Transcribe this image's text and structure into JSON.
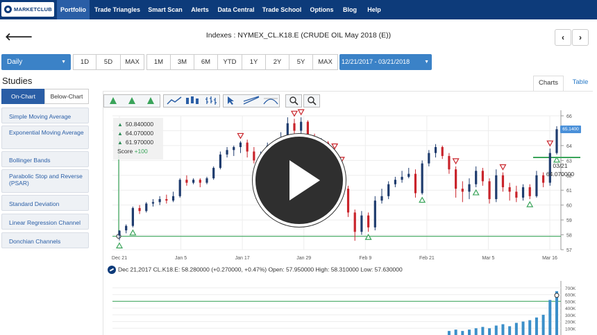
{
  "brand": {
    "logo_text": "MARKETCLUB"
  },
  "nav": {
    "items": [
      {
        "label": "Portfolio",
        "active": true
      },
      {
        "label": "Trade Triangles"
      },
      {
        "label": "Smart Scan"
      },
      {
        "label": "Alerts"
      },
      {
        "label": "Data Central"
      },
      {
        "label": "Trade School"
      },
      {
        "label": "Options"
      },
      {
        "label": "Blog"
      },
      {
        "label": "Help"
      }
    ]
  },
  "header": {
    "back_glyph": "🡐",
    "title": "Indexes : NYMEX_CL.K18.E (CRUDE OIL May 2018 (E))",
    "prev_glyph": "‹",
    "next_glyph": "›"
  },
  "range_bar": {
    "period": "Daily",
    "short_ranges": [
      "1D",
      "5D",
      "MAX"
    ],
    "long_ranges": [
      "1M",
      "3M",
      "6M",
      "YTD",
      "1Y",
      "2Y",
      "5Y",
      "MAX"
    ],
    "date_range": "12/21/2017 - 03/21/2018"
  },
  "studies": {
    "title": "Studies",
    "tabs": [
      "On-Chart",
      "Below-Chart"
    ],
    "items": [
      "Simple Moving Average",
      "Exponential Moving Average",
      "Bollinger Bands",
      "Parabolic Stop and Reverse (PSAR)",
      "Standard Deviation",
      "Linear Regression Channel",
      "Donchian Channels"
    ]
  },
  "view_tabs": {
    "charts": "Charts",
    "table": "Table"
  },
  "summary": {
    "levels": [
      "50.840000",
      "64.070000",
      "61.970000"
    ],
    "score_label": "Score",
    "score_value": "+100"
  },
  "readout": {
    "last_price_tag": "65.1400",
    "tooltip_date": "03/21",
    "tooltip_value": "64.070000",
    "info_line": "Dec 21,2017 CL.K18.E: 58.280000 (+0.270000, +0.47%) Open: 57.950000 High: 58.310000 Low: 57.630000"
  },
  "colors": {
    "nav_bg": "#0d3b7a",
    "nav_active": "#2a5ea6",
    "accent": "#3b82c7",
    "up_candle": "#1f3c6e",
    "down_candle": "#c9242b",
    "signal_line": "#3aa45a",
    "volume_bar": "#3b8fc9"
  },
  "chart_data": [
    {
      "type": "candlestick",
      "y_ticks": [
        "66",
        "64",
        "63",
        "62",
        "61",
        "60",
        "59",
        "58",
        "57"
      ],
      "x_ticks": [
        "Dec 21",
        "Jan 5",
        "Jan 17",
        "Jan 29",
        "Feb 9",
        "Feb 21",
        "Mar 5",
        "Mar 16"
      ],
      "ylim": [
        57,
        66
      ],
      "horizontal_lines": [
        57.9,
        63.2
      ],
      "candles": [
        {
          "o": 57.95,
          "c": 58.28,
          "h": 58.31,
          "l": 57.63
        },
        {
          "o": 58.3,
          "c": 58.6,
          "h": 58.7,
          "l": 58.1
        },
        {
          "o": 58.6,
          "c": 59.8,
          "h": 59.9,
          "l": 58.5
        },
        {
          "o": 59.8,
          "c": 59.6,
          "h": 60.0,
          "l": 59.4
        },
        {
          "o": 59.6,
          "c": 60.1,
          "h": 60.2,
          "l": 59.5
        },
        {
          "o": 60.1,
          "c": 60.2,
          "h": 60.4,
          "l": 59.9
        },
        {
          "o": 60.2,
          "c": 60.4,
          "h": 60.6,
          "l": 60.0
        },
        {
          "o": 60.4,
          "c": 60.3,
          "h": 60.7,
          "l": 60.1
        },
        {
          "o": 60.3,
          "c": 60.6,
          "h": 60.9,
          "l": 60.2
        },
        {
          "o": 60.6,
          "c": 61.7,
          "h": 61.8,
          "l": 60.5
        },
        {
          "o": 61.7,
          "c": 61.5,
          "h": 62.0,
          "l": 61.3
        },
        {
          "o": 61.5,
          "c": 61.7,
          "h": 61.8,
          "l": 61.4
        },
        {
          "o": 61.7,
          "c": 61.5,
          "h": 61.8,
          "l": 61.2
        },
        {
          "o": 61.5,
          "c": 61.8,
          "h": 61.9,
          "l": 61.4
        },
        {
          "o": 61.8,
          "c": 62.5,
          "h": 62.6,
          "l": 61.7
        },
        {
          "o": 62.5,
          "c": 63.4,
          "h": 63.6,
          "l": 62.4
        },
        {
          "o": 63.4,
          "c": 63.7,
          "h": 63.9,
          "l": 63.2
        },
        {
          "o": 63.7,
          "c": 63.9,
          "h": 64.0,
          "l": 63.3
        },
        {
          "o": 63.9,
          "c": 64.2,
          "h": 64.3,
          "l": 63.5
        },
        {
          "o": 64.2,
          "c": 63.6,
          "h": 64.4,
          "l": 63.2
        },
        {
          "o": 63.6,
          "c": 63.0,
          "h": 63.9,
          "l": 62.8
        },
        {
          "o": 63.0,
          "c": 63.4,
          "h": 63.6,
          "l": 62.6
        },
        {
          "o": 63.4,
          "c": 64.0,
          "h": 64.2,
          "l": 63.1
        },
        {
          "o": 64.0,
          "c": 63.7,
          "h": 64.3,
          "l": 63.3
        },
        {
          "o": 63.7,
          "c": 64.5,
          "h": 64.9,
          "l": 63.5
        },
        {
          "o": 64.5,
          "c": 65.5,
          "h": 65.9,
          "l": 64.4
        },
        {
          "o": 65.5,
          "c": 65.0,
          "h": 65.8,
          "l": 64.8
        },
        {
          "o": 65.0,
          "c": 65.6,
          "h": 65.9,
          "l": 64.7
        },
        {
          "o": 65.6,
          "c": 64.6,
          "h": 65.7,
          "l": 64.3
        },
        {
          "o": 64.6,
          "c": 64.0,
          "h": 64.8,
          "l": 63.7
        },
        {
          "o": 64.0,
          "c": 64.2,
          "h": 64.5,
          "l": 63.5
        },
        {
          "o": 64.2,
          "c": 63.4,
          "h": 64.3,
          "l": 62.9
        },
        {
          "o": 63.4,
          "c": 62.5,
          "h": 63.6,
          "l": 62.2
        },
        {
          "o": 62.5,
          "c": 61.1,
          "h": 62.7,
          "l": 60.8
        },
        {
          "o": 61.1,
          "c": 59.5,
          "h": 61.3,
          "l": 59.2
        },
        {
          "o": 59.5,
          "c": 58.2,
          "h": 59.7,
          "l": 57.6
        },
        {
          "o": 58.2,
          "c": 59.3,
          "h": 59.6,
          "l": 58.0
        },
        {
          "o": 59.3,
          "c": 58.5,
          "h": 59.5,
          "l": 58.2
        },
        {
          "o": 58.5,
          "c": 60.3,
          "h": 60.6,
          "l": 58.3
        },
        {
          "o": 60.3,
          "c": 60.6,
          "h": 61.1,
          "l": 60.1
        },
        {
          "o": 60.6,
          "c": 61.4,
          "h": 61.6,
          "l": 60.4
        },
        {
          "o": 61.4,
          "c": 61.7,
          "h": 61.9,
          "l": 61.2
        },
        {
          "o": 61.7,
          "c": 61.9,
          "h": 62.3,
          "l": 61.5
        },
        {
          "o": 61.9,
          "c": 62.1,
          "h": 62.5,
          "l": 61.8
        },
        {
          "o": 62.1,
          "c": 60.8,
          "h": 62.4,
          "l": 60.5
        },
        {
          "o": 60.8,
          "c": 62.8,
          "h": 63.0,
          "l": 60.7
        },
        {
          "o": 62.8,
          "c": 63.5,
          "h": 63.7,
          "l": 62.6
        },
        {
          "o": 63.5,
          "c": 63.9,
          "h": 64.1,
          "l": 63.2
        },
        {
          "o": 63.9,
          "c": 63.3,
          "h": 64.0,
          "l": 63.1
        },
        {
          "o": 63.3,
          "c": 62.4,
          "h": 63.5,
          "l": 62.1
        },
        {
          "o": 62.4,
          "c": 61.1,
          "h": 62.6,
          "l": 60.5
        },
        {
          "o": 61.1,
          "c": 60.9,
          "h": 61.6,
          "l": 60.2
        },
        {
          "o": 60.9,
          "c": 61.4,
          "h": 61.8,
          "l": 60.4
        },
        {
          "o": 61.4,
          "c": 62.3,
          "h": 62.6,
          "l": 61.2
        },
        {
          "o": 62.3,
          "c": 61.6,
          "h": 62.5,
          "l": 61.3
        },
        {
          "o": 61.6,
          "c": 60.4,
          "h": 61.8,
          "l": 60.1
        },
        {
          "o": 60.4,
          "c": 62.0,
          "h": 62.4,
          "l": 60.2
        },
        {
          "o": 62.0,
          "c": 61.2,
          "h": 62.2,
          "l": 60.9
        },
        {
          "o": 61.2,
          "c": 60.9,
          "h": 61.5,
          "l": 60.3
        },
        {
          "o": 60.9,
          "c": 60.5,
          "h": 61.3,
          "l": 60.2
        },
        {
          "o": 60.5,
          "c": 61.2,
          "h": 61.4,
          "l": 60.3
        },
        {
          "o": 61.2,
          "c": 60.6,
          "h": 61.4,
          "l": 60.4
        },
        {
          "o": 60.6,
          "c": 62.0,
          "h": 62.3,
          "l": 60.5
        },
        {
          "o": 62.0,
          "c": 61.5,
          "h": 62.2,
          "l": 61.2
        },
        {
          "o": 61.5,
          "c": 63.5,
          "h": 63.8,
          "l": 61.3
        },
        {
          "o": 63.5,
          "c": 65.1,
          "h": 65.3,
          "l": 63.4
        }
      ],
      "buy_signals": [
        0,
        2,
        29,
        37,
        45,
        53,
        61,
        65
      ],
      "sell_signals": [
        18,
        26,
        27,
        32,
        33,
        50,
        57,
        64
      ]
    },
    {
      "type": "bar",
      "title": "",
      "y_ticks": [
        "700K",
        "600K",
        "500K",
        "400K",
        "300K",
        "200K",
        "100K"
      ],
      "ylim": [
        0,
        700000
      ],
      "reference_line": 500000,
      "values": [
        0,
        0,
        0,
        0,
        0,
        0,
        0,
        0,
        0,
        0,
        0,
        0,
        0,
        0,
        0,
        0,
        0,
        0,
        0,
        0,
        0,
        0,
        0,
        0,
        0,
        0,
        0,
        0,
        0,
        0,
        0,
        0,
        0,
        0,
        0,
        0,
        0,
        0,
        0,
        0,
        0,
        0,
        0,
        0,
        0,
        0,
        0,
        0,
        0,
        60000,
        80000,
        60000,
        80000,
        100000,
        120000,
        100000,
        140000,
        160000,
        130000,
        180000,
        200000,
        220000,
        260000,
        300000,
        520000,
        650000
      ]
    }
  ]
}
